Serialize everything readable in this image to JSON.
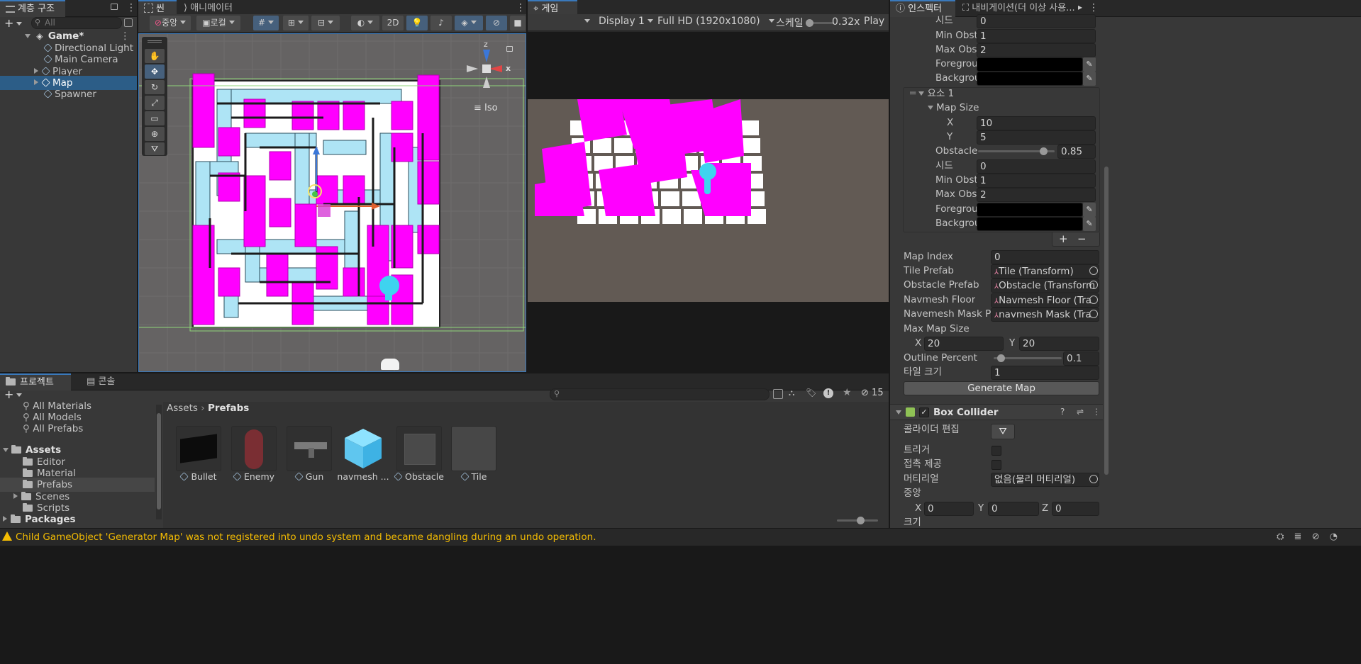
{
  "hierarchy": {
    "tab": "계층 구조",
    "search_placeholder": "All",
    "scene": "Game*",
    "items": [
      "Directional Light",
      "Main Camera",
      "Player",
      "Map",
      "Spawner"
    ]
  },
  "scene_view": {
    "tab_scene": "씬",
    "tab_animator": "애니메이터",
    "pivot": "중앙",
    "space": "로컬",
    "mode_2d": "2D",
    "iso_label": "Iso",
    "gizmo_x": "x",
    "gizmo_z": "z"
  },
  "game_view": {
    "tab": "게임",
    "display": "Display 1",
    "resolution": "Full HD (1920x1080)",
    "scale_label": "스케일",
    "scale_value": "0.32x",
    "play": "Play F"
  },
  "inspector": {
    "tab": "인스펙터",
    "tab_nav": "내비게이션(더 이상 사용...",
    "top": {
      "seed_label": "시드",
      "seed": "0",
      "min_label": "Min Obsta",
      "min": "1",
      "max_label": "Max Obst",
      "max": "2",
      "fg_label": "Foregrou",
      "bg_label": "Backgrou"
    },
    "element": {
      "label": "요소 1",
      "map_size": "Map Size",
      "x_label": "X",
      "x": "10",
      "y_label": "Y",
      "y": "5",
      "obstacle_label": "Obstacle",
      "obstacle": "0.85",
      "obstacle_fraction": 0.85,
      "seed_label": "시드",
      "seed": "0",
      "min_label": "Min Obst",
      "min": "1",
      "max_label": "Max Obst",
      "max": "2",
      "fg_label": "Foregrou",
      "bg_label": "Backgrou"
    },
    "plus": "+",
    "minus": "−",
    "map_index_label": "Map Index",
    "map_index": "0",
    "tile_prefab_label": "Tile Prefab",
    "tile_prefab": "Tile (Transform)",
    "obstacle_prefab_label": "Obstacle Prefab",
    "obstacle_prefab": "Obstacle (Transform",
    "navmesh_floor_label": "Navmesh Floor",
    "navmesh_floor": "Navmesh Floor (Tra",
    "navmesh_mask_label": "Navemesh Mask Pre",
    "navmesh_mask": "navmesh Mask (Tra",
    "max_map_size_label": "Max Map Size",
    "mx_label": "X",
    "mx": "20",
    "my_label": "Y",
    "my": "20",
    "outline_label": "Outline Percent",
    "outline": "0.1",
    "outline_fraction": 0.1,
    "tile_size_label": "타일 크기",
    "tile_size": "1",
    "generate": "Generate Map",
    "collider": {
      "title": "Box Collider",
      "edit_label": "콜라이더 편집",
      "trigger_label": "트리거",
      "contact_label": "접촉 제공",
      "material_label": "머티리얼",
      "material": "없음(물리 머티리얼)",
      "center_label": "중앙",
      "cx_label": "X",
      "cx": "0",
      "cy_label": "Y",
      "cy": "0",
      "cz_label": "Z",
      "cz": "0",
      "size_label": "크기"
    }
  },
  "project": {
    "tab_project": "프로젝트",
    "tab_console": "콘솔",
    "hidden_count": "15",
    "tree": [
      "All Materials",
      "All Models",
      "All Prefabs",
      "Assets",
      "Editor",
      "Material",
      "Prefabs",
      "Scenes",
      "Scripts",
      "Packages"
    ],
    "breadcrumb_root": "Assets",
    "breadcrumb_current": "Prefabs",
    "assets": [
      "Bullet",
      "Enemy",
      "Gun",
      "navmesh ...",
      "Obstacle",
      "Tile"
    ]
  },
  "status": {
    "message": "Child GameObject 'Generator Map' was not registered into undo system and became dangling during an undo operation."
  },
  "colors": {
    "accent": "#3a79bb",
    "selection": "#2c5d87",
    "magenta": "#ff00ff",
    "walkable": "#aee4f5",
    "warning": "#f4bc02"
  }
}
